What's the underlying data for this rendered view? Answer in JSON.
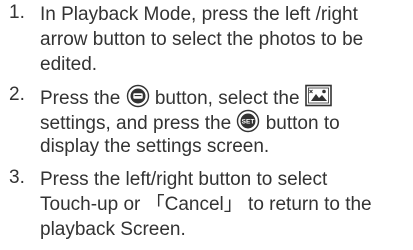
{
  "steps": [
    {
      "number": "1.",
      "lines": [
        "In Playback Mode, press the left /right",
        "arrow button to select the photos to be",
        "edited."
      ]
    },
    {
      "number": "2.",
      "line1_a": "Press the ",
      "line1_b": " button, select the ",
      "line2_a": "settings, and press the ",
      "line2_b": " button to",
      "line3": "display the settings screen.",
      "icons": {
        "menu_button": "menu-button-icon",
        "touch_up": "touch-up-icon",
        "set_button": "set-button-icon",
        "set_label": "SET"
      }
    },
    {
      "number": "3.",
      "lines": [
        "Press the left/right button to select",
        "Touch-up or 「Cancel」 to return to the",
        "playback Screen."
      ]
    }
  ]
}
